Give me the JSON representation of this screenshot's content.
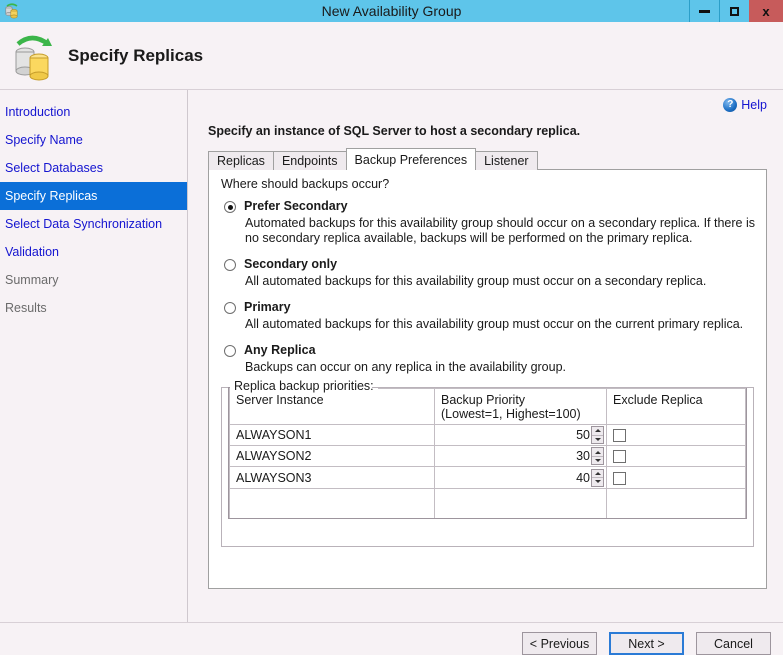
{
  "window": {
    "title": "New Availability Group",
    "app_icon": "availability-group-icon",
    "controls": {
      "minimize": "minimize-icon",
      "maximize": "maximize-icon",
      "close": "x"
    },
    "titlebar_color": "#5ec5ea",
    "close_color": "#c75b5b"
  },
  "header": {
    "title": "Specify Replicas",
    "icon": "database-replica-icon"
  },
  "sidebar": {
    "items": [
      {
        "label": "Introduction",
        "state": "link"
      },
      {
        "label": "Specify Name",
        "state": "link"
      },
      {
        "label": "Select Databases",
        "state": "link"
      },
      {
        "label": "Specify Replicas",
        "state": "active"
      },
      {
        "label": "Select Data Synchronization",
        "state": "link"
      },
      {
        "label": "Validation",
        "state": "link"
      },
      {
        "label": "Summary",
        "state": "disabled"
      },
      {
        "label": "Results",
        "state": "disabled"
      }
    ],
    "active_background": "#0b6fd8",
    "link_color": "#1414d0",
    "disabled_color": "#6b6b6b"
  },
  "main": {
    "help_label": "Help",
    "help_icon": "question-mark-icon",
    "instruction": "Specify an instance of SQL Server to host a secondary replica.",
    "tabs": [
      {
        "label": "Replicas",
        "active": false
      },
      {
        "label": "Endpoints",
        "active": false
      },
      {
        "label": "Backup Preferences",
        "active": true
      },
      {
        "label": "Listener",
        "active": false
      }
    ],
    "panel_question": "Where should backups occur?",
    "backup_options": [
      {
        "label": "Prefer Secondary",
        "selected": true,
        "description": "Automated backups for this availability group should occur on a secondary replica. If there is no secondary replica available, backups will be performed on the primary replica."
      },
      {
        "label": "Secondary only",
        "selected": false,
        "description": "All automated backups for this availability group must occur on a secondary replica."
      },
      {
        "label": "Primary",
        "selected": false,
        "description": "All automated backups for this availability group must occur on the current primary replica."
      },
      {
        "label": "Any Replica",
        "selected": false,
        "description": "Backups can occur on any replica in the availability group."
      }
    ],
    "priorities": {
      "group_label": "Replica backup priorities:",
      "columns": {
        "instance": "Server Instance",
        "priority_line1": "Backup Priority",
        "priority_line2": "(Lowest=1, Highest=100)",
        "exclude": "Exclude Replica"
      },
      "rows": [
        {
          "instance": "ALWAYSON1",
          "priority": "50",
          "exclude": false
        },
        {
          "instance": "ALWAYSON2",
          "priority": "30",
          "exclude": false
        },
        {
          "instance": "ALWAYSON3",
          "priority": "40",
          "exclude": false
        }
      ]
    }
  },
  "footer": {
    "previous_label": "< Previous",
    "next_label": "Next >",
    "cancel_label": "Cancel",
    "focused_button": "Next >"
  }
}
